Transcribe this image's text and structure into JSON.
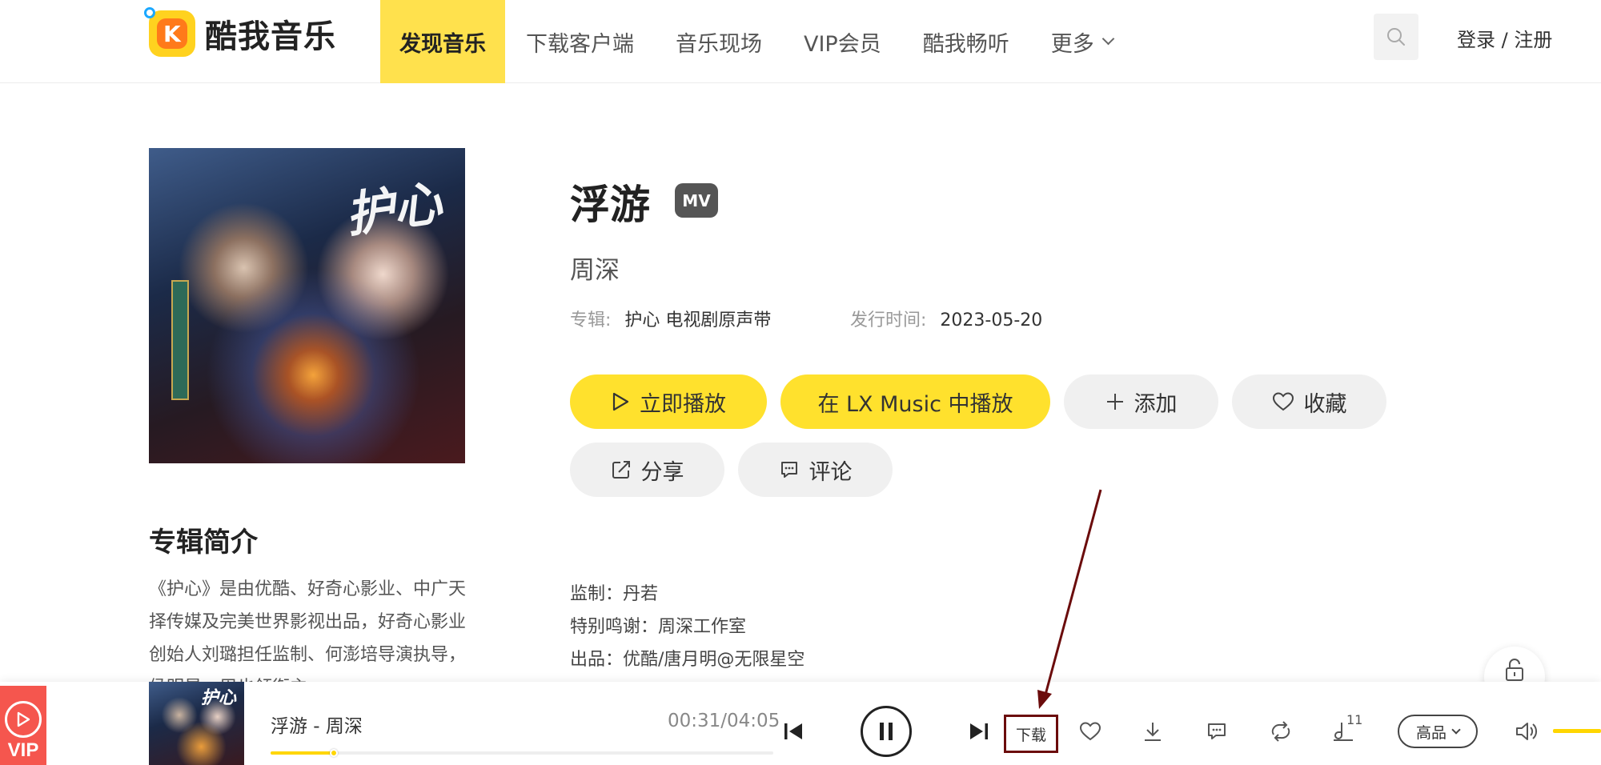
{
  "app": {
    "logo_text": "酷我音乐"
  },
  "nav": {
    "items": [
      {
        "label": "发现音乐",
        "active": true
      },
      {
        "label": "下载客户端"
      },
      {
        "label": "音乐现场"
      },
      {
        "label": "VIP会员"
      },
      {
        "label": "酷我畅听"
      },
      {
        "label": "更多"
      }
    ],
    "login_label": "登录 / 注册"
  },
  "album": {
    "cover_calligraphy": "护心",
    "intro_title": "专辑简介",
    "intro_text": "《护心》是由优酷、好奇心影业、中广天择传媒及完美世界影视出品，好奇心影业创始人刘璐担任监制、何澎培导演执导，侯明昊、周也领衔主"
  },
  "song": {
    "title": "浮游",
    "mv_badge": "MV",
    "artist": "周深",
    "album_label": "专辑:",
    "album_value": "护心 电视剧原声带",
    "release_label": "发行时间:",
    "release_value": "2023-05-20"
  },
  "actions": {
    "play_now": "立即播放",
    "play_lx": "在 LX Music 中播放",
    "add": "添加",
    "favorite": "收藏",
    "share": "分享",
    "comment": "评论"
  },
  "credits": [
    "监制：丹若",
    "特别鸣谢：周深工作室",
    "出品：优酷/唐月明@无限星空"
  ],
  "player": {
    "vip_label": "VIP",
    "now_playing": "浮游 - 周深",
    "time": "00:31/04:05",
    "progress": 0.126,
    "download_label": "下载",
    "playlist_count": "11",
    "quality_label": "高品",
    "volume": 1.0
  },
  "colors": {
    "accent_yellow": "#ffe12d",
    "annotation_red": "#6b0c0c",
    "vip_red": "#f5564e"
  }
}
